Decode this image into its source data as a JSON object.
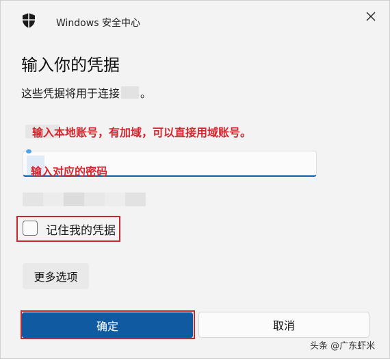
{
  "window": {
    "title": "Windows 安全中心",
    "icon": "shield-icon",
    "close_icon": "close-icon"
  },
  "dialog": {
    "heading": "输入你的凭据",
    "subtitle_prefix": "这些凭据将用于连接",
    "subtitle_suffix": "。"
  },
  "annotations": {
    "note1": "输入本地账号，有加域，可以直接用域账号。",
    "note2": "输入对应的密码",
    "color": "#d6262e"
  },
  "form": {
    "username_value": "",
    "remember_label": "记住我的凭据",
    "remember_checked": false,
    "more_options_label": "更多选项"
  },
  "actions": {
    "ok_label": "确定",
    "cancel_label": "取消",
    "ok_color": "#0f5aa0"
  },
  "watermark": {
    "text": "头条 @广东虾米"
  }
}
